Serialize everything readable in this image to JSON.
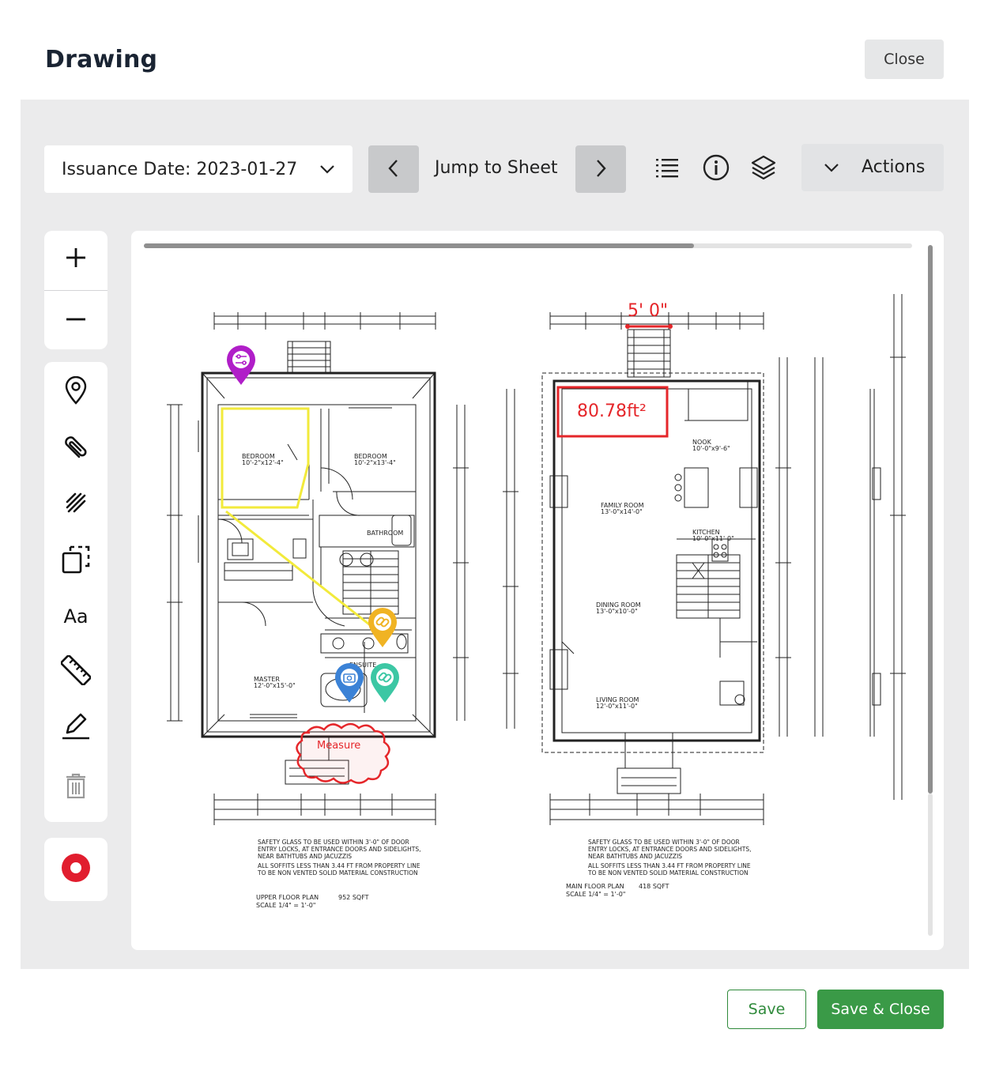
{
  "dialog": {
    "title": "Drawing",
    "close_label": "Close"
  },
  "toolbar": {
    "issuance_date": "Issuance Date: 2023-01-27",
    "jump_label": "Jump to Sheet",
    "actions_label": "Actions",
    "icons": [
      "chevron-left-icon",
      "chevron-right-icon",
      "list-icon",
      "info-icon",
      "layers-icon",
      "chevron-down-icon"
    ]
  },
  "tools": {
    "items": [
      "zoom-in",
      "zoom-out",
      "pin",
      "attach",
      "draw-freehand",
      "copy-area",
      "text",
      "measure",
      "pencil",
      "trash",
      "record"
    ],
    "text_tool_label": "Aa"
  },
  "drawing": {
    "measure_length": "5' 0\"",
    "area_measure": "80.78ft²",
    "cloud_label": "Measure",
    "upper_plan": {
      "title": "UPPER FLOOR PLAN",
      "area": "952 SQFT",
      "scale": "SCALE 1/4\" = 1'-0\"",
      "rooms": [
        {
          "name": "BEDROOM",
          "dim": "10'-2\"x12'-4\""
        },
        {
          "name": "BEDROOM",
          "dim": "10'-2\"x13'-4\""
        },
        {
          "name": "MASTER",
          "dim": "12'-0\"x15'-0\""
        },
        {
          "name": "ENSUITE",
          "dim": ""
        },
        {
          "name": "BATHROOM",
          "dim": ""
        }
      ],
      "notes": "SAFETY GLASS TO BE USED WITHIN 3'-0\" OF DOOR ENTRY LOCKS, AT ENTRANCE DOORS AND SIDELIGHTS, NEAR BATHTUBS AND JACUZZIS. ALL SOFFITS LESS THAN 3.44 FT FROM PROPERTY LINE TO BE NON VENTED SOLID MATERIAL CONSTRUCTION"
    },
    "main_plan": {
      "title": "MAIN FLOOR PLAN",
      "area": "418 SQFT",
      "scale": "SCALE 1/4\" = 1'-0\"",
      "rooms": [
        {
          "name": "NOOK",
          "dim": "10'-0\"x9'-6\""
        },
        {
          "name": "FAMILY ROOM",
          "dim": "13'-0\"x14'-0\""
        },
        {
          "name": "KITCHEN",
          "dim": "10'-0\"x11'-0\""
        },
        {
          "name": "DINING ROOM",
          "dim": "13'-0\"x10'-0\""
        },
        {
          "name": "LIVING ROOM",
          "dim": "12'-0\"x11'-0\""
        }
      ],
      "notes": "SAFETY GLASS TO BE USED WITHIN 3'-0\" OF DOOR ENTRY LOCKS, AT ENTRANCE DOORS AND SIDELIGHTS, NEAR BATHTUBS AND JACUZZIS. ALL SOFFITS LESS THAN 3.44 FT FROM PROPERTY LINE TO BE NON VENTED SOLID MATERIAL CONSTRUCTION"
    },
    "markers": [
      {
        "name": "settings-marker",
        "color": "#b01ec8"
      },
      {
        "name": "link-marker",
        "color": "#f0b323"
      },
      {
        "name": "camera-marker",
        "color": "#3b82d6"
      },
      {
        "name": "link-marker",
        "color": "#3cc7a4"
      }
    ]
  },
  "footer": {
    "save_label": "Save",
    "save_close_label": "Save & Close"
  },
  "colors": {
    "save_green": "#3a9a47",
    "record_red": "#e11d2e",
    "highlight_yellow": "#f2ea3b",
    "measure_red": "#e5262a"
  }
}
